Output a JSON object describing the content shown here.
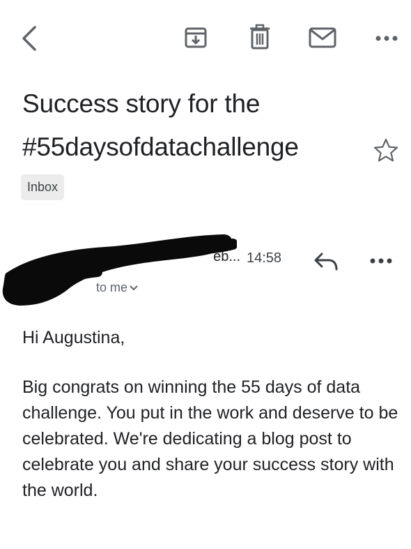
{
  "toolbar": {
    "back_icon": "back-arrow-icon",
    "archive_icon": "archive-icon",
    "delete_icon": "trash-icon",
    "mark_unread_icon": "mail-icon",
    "more_icon": "more-horizontal-icon"
  },
  "email": {
    "subject": "Success story for the #55daysofdatachallenge",
    "starred": false,
    "label": "Inbox",
    "sender_truncated": "eb...",
    "time": "14:58",
    "recipient": "to me",
    "greeting": "Hi Augustina,",
    "body": "Big congrats on winning the 55 days of data challenge. You put in the work and deserve to be celebrated. We're dedicating a blog post to celebrate you and share your success story with the world."
  },
  "colors": {
    "text": "#202124",
    "secondary_text": "#5f6368",
    "icon": "#5f6368",
    "chip_background": "#ececec",
    "redaction": "#0a0a0a"
  }
}
